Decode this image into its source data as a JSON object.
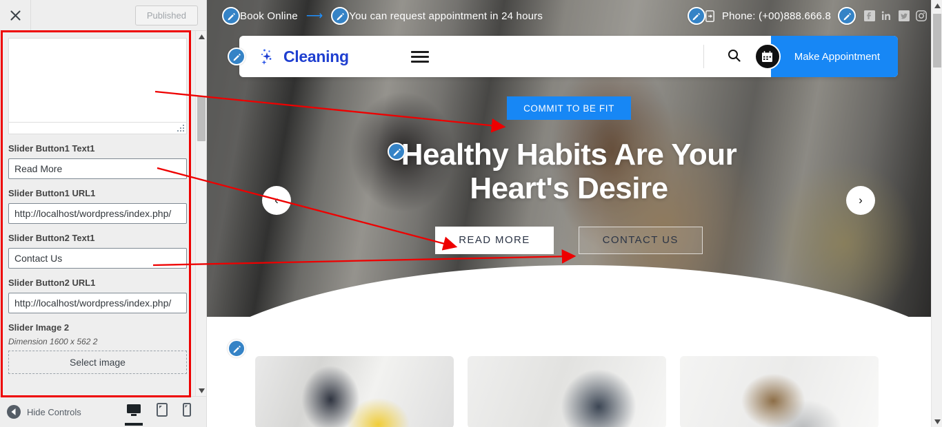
{
  "customizer": {
    "close_icon": "close-icon",
    "published_label": "Published",
    "textarea_value": "",
    "controls": [
      {
        "label": "Slider Button1 Text1",
        "value": "Read More"
      },
      {
        "label": "Slider Button1 URL1",
        "value": "http://localhost/wordpress/index.php/"
      },
      {
        "label": "Slider Button2 Text1",
        "value": "Contact Us"
      },
      {
        "label": "Slider Button2 URL1",
        "value": "http://localhost/wordpress/index.php/"
      }
    ],
    "image_control": {
      "label": "Slider Image 2",
      "dimension": "Dimension 1600 x 562 2",
      "button": "Select image"
    },
    "footer": {
      "hide_controls": "Hide Controls",
      "devices": [
        "desktop-icon",
        "tablet-icon",
        "mobile-icon"
      ],
      "active_device": "desktop-icon"
    }
  },
  "preview": {
    "topbar": {
      "book_online": "Book Online",
      "arrow_icon": "arrow-right-icon",
      "appointment_note": "You can request appointment in 24 hours",
      "phone_icon": "mobile-phone-icon",
      "phone": "Phone: (+00)888.666.8",
      "socials": [
        "facebook-icon",
        "linkedin-icon",
        "twitter-icon",
        "instagram-icon"
      ]
    },
    "nav": {
      "logo_icon": "sparkle-icon",
      "brand": "Cleaning",
      "menu_icon": "hamburger-icon",
      "search_icon": "search-icon",
      "calendar_icon": "calendar-icon",
      "appointment_button": "Make Appointment"
    },
    "hero": {
      "badge_button": "COMMIT TO BE FIT",
      "title": "Healthy Habits Are Your Heart's Desire",
      "primary_button": "READ MORE",
      "secondary_button": "CONTACT US",
      "prev_icon": "chevron-left-icon",
      "next_icon": "chevron-right-icon"
    },
    "edit_icon": "pencil-edit-icon"
  },
  "colors": {
    "accent_blue": "#1787f5",
    "brand_blue": "#1f3fd0",
    "pencil_blue": "#3583c6",
    "annotation_red": "#ee0000",
    "panel_bg": "#eeeeee"
  }
}
